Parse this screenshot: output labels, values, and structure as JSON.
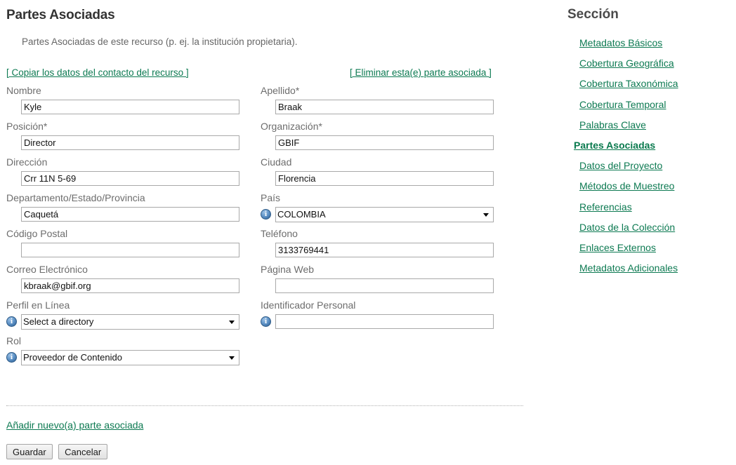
{
  "page": {
    "title": "Partes Asociadas",
    "description": "Partes Asociadas de este recurso (p. ej. la institución propietaria)."
  },
  "top_links": {
    "copy": "[ Copiar los datos del contacto del recurso ]",
    "remove": "[ Eliminar esta(e) parte asociada ]"
  },
  "form": {
    "left": [
      {
        "label": "Nombre",
        "value": "Kyle",
        "type": "text",
        "info": false
      },
      {
        "label": "Posición*",
        "value": "Director",
        "type": "text",
        "info": false
      },
      {
        "label": "Dirección",
        "value": "Crr 11N 5-69",
        "type": "text",
        "info": false
      },
      {
        "label": "Departamento/Estado/Provincia",
        "value": "Caquetá",
        "type": "text",
        "info": false
      },
      {
        "label": "Código Postal",
        "value": "",
        "type": "text",
        "info": false
      },
      {
        "label": "Correo Electrónico",
        "value": "kbraak@gbif.org",
        "type": "text",
        "info": false
      },
      {
        "label": "Perfil en Línea",
        "value": "Select a directory",
        "type": "select",
        "info": true
      },
      {
        "label": "Rol",
        "value": "Proveedor de Contenido",
        "type": "select",
        "info": true
      }
    ],
    "right": [
      {
        "label": "Apellido*",
        "value": "Braak",
        "type": "text",
        "info": false
      },
      {
        "label": "Organización*",
        "value": "GBIF",
        "type": "text",
        "info": false
      },
      {
        "label": "Ciudad",
        "value": "Florencia",
        "type": "text",
        "info": false
      },
      {
        "label": "País",
        "value": "COLOMBIA",
        "type": "select",
        "info": true
      },
      {
        "label": "Teléfono",
        "value": "3133769441",
        "type": "text",
        "info": false
      },
      {
        "label": "Página Web",
        "value": "",
        "type": "text",
        "info": false
      },
      {
        "label": "Identificador Personal",
        "value": "",
        "type": "text",
        "info": true
      }
    ]
  },
  "bottom": {
    "add_link": "Añadir nuevo(a) parte asociada",
    "save_label": "Guardar",
    "cancel_label": "Cancelar"
  },
  "sidebar": {
    "title": "Sección",
    "items": [
      {
        "label": "Metadatos Básicos",
        "active": false
      },
      {
        "label": "Cobertura Geográfica",
        "active": false
      },
      {
        "label": "Cobertura Taxonómica",
        "active": false
      },
      {
        "label": "Cobertura Temporal",
        "active": false
      },
      {
        "label": "Palabras Clave",
        "active": false
      },
      {
        "label": "Partes Asociadas",
        "active": true
      },
      {
        "label": "Datos del Proyecto",
        "active": false
      },
      {
        "label": "Métodos de Muestreo",
        "active": false
      },
      {
        "label": "Referencias",
        "active": false
      },
      {
        "label": "Datos de la Colección",
        "active": false
      },
      {
        "label": "Enlaces Externos",
        "active": false
      },
      {
        "label": "Metadatos Adicionales",
        "active": false
      }
    ]
  },
  "colors": {
    "link": "#0d7a52",
    "label": "#6d6d6d",
    "title": "#333333",
    "info_icon": "#5f93c7"
  }
}
